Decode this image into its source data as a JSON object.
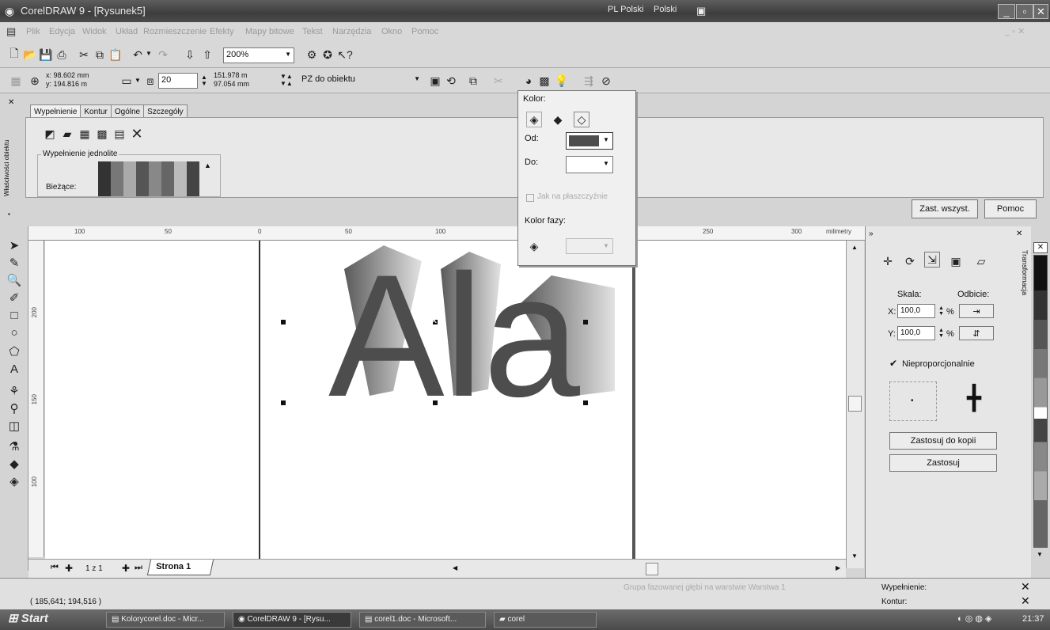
{
  "window": {
    "title": "CorelDRAW 9 - [Rysunek5]",
    "lang1": "PL Polski",
    "lang2": "Polski"
  },
  "menu": [
    "Plik",
    "Edycja",
    "Widok",
    "Układ",
    "Rozmieszczenie",
    "Efekty",
    "Mapy bitowe",
    "Tekst",
    "Narzędzia",
    "Okno",
    "Pomoc"
  ],
  "toolbar1": {
    "zoom": "200%"
  },
  "toolbar2": {
    "pos_x": "x: 98.602 mm",
    "pos_y": "y: 194.816 m",
    "depth": "20",
    "vp_x": "151.978 m",
    "vp_y": "97.054 mm",
    "vp_lock": "PZ do obiektu"
  },
  "props": {
    "side_label": "Właściwości obiektu",
    "tabs": [
      "Wypełnienie",
      "Kontur",
      "Ogólne",
      "Szczegóły"
    ],
    "fill_group": "Wypełnienie jednolite",
    "current_label": "Bieżące:",
    "reset_button": "Zast. wszyst.",
    "help_button": "Pomoc"
  },
  "popup": {
    "color_label": "Kolor:",
    "from_label": "Od:",
    "to_label": "Do:",
    "flat_label": "Jak na płaszczyźnie",
    "bevel_label": "Kolor fazy:"
  },
  "canvas": {
    "text": "Ala",
    "ruler_units": "milimetry"
  },
  "ruler_h": [
    "100",
    "50",
    "0",
    "50",
    "100",
    "250",
    "300"
  ],
  "ruler_v": [
    "200",
    "150",
    "100"
  ],
  "pages": {
    "count": "1 z 1",
    "tab": "Strona 1"
  },
  "docker": {
    "side_tab": "Transformacja",
    "scale_label": "Skala:",
    "mirror_label": "Odbicie:",
    "x_label": "X:",
    "y_label": "Y:",
    "x_value": "100,0",
    "y_value": "100,0",
    "percent": "%",
    "nonprop_label": "Nieproporcjonalnie",
    "apply_copy": "Zastosuj do kopii",
    "apply": "Zastosuj"
  },
  "status": {
    "coords": "( 185,641; 194,516 )",
    "info": "Grupa fazowanej głębi na warstwie Warstwa 1",
    "fill_label": "Wypełnienie:",
    "outline_label": "Kontur:"
  },
  "taskbar": {
    "start": "Start",
    "tasks": [
      "Kolorycorel.doc - Micr...",
      "CorelDRAW 9 - [Rysu...",
      "corel1.doc - Microsoft...",
      "corel"
    ],
    "clock": "21:37"
  },
  "colors": {
    "title_bg": "#4a4a4a",
    "text_fill": "#4d4d4d"
  }
}
